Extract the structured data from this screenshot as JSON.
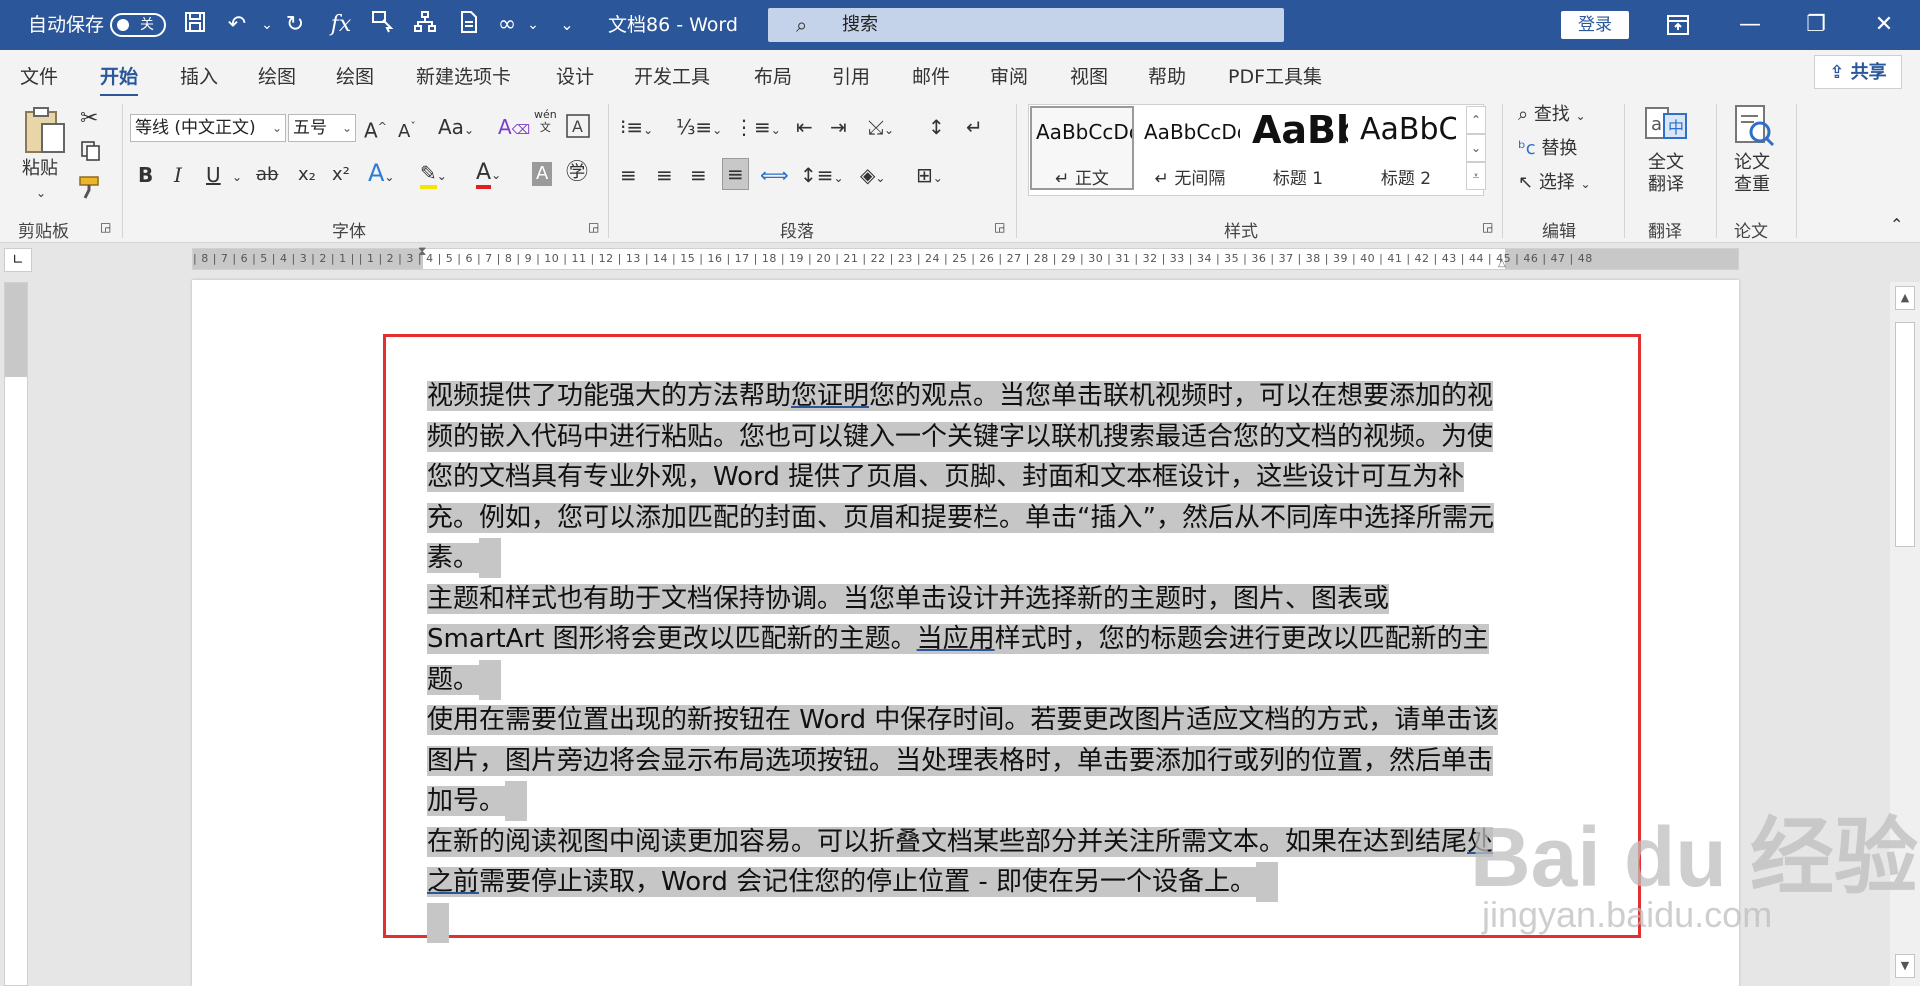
{
  "titlebar": {
    "autosave_label": "自动保存",
    "autosave_state": "关",
    "doc_title": "文档86  -  Word",
    "search_placeholder": "搜索",
    "login_label": "登录",
    "bg_color": "#2b579a"
  },
  "tabs": [
    "文件",
    "开始",
    "插入",
    "绘图",
    "绘图",
    "新建选项卡",
    "设计",
    "开发工具",
    "布局",
    "引用",
    "邮件",
    "审阅",
    "视图",
    "帮助",
    "PDF工具集"
  ],
  "active_tab": "开始",
  "share_label": "共享",
  "ribbon": {
    "clipboard": {
      "paste": "粘贴",
      "label": "剪贴板"
    },
    "font": {
      "font_name": "等线 (中文正文)",
      "font_size": "五号",
      "label": "字体",
      "grow": "A^",
      "shrink": "Aˇ",
      "case": "Aa",
      "bold": "B",
      "italic": "I",
      "underline": "U",
      "strike": "ab",
      "sub": "x₂",
      "sup": "x²",
      "phonetic": "wén\n文"
    },
    "paragraph": {
      "label": "段落"
    },
    "styles": {
      "label": "样式",
      "items": [
        {
          "preview": "AaBbCcDd",
          "name": "↵ 正文"
        },
        {
          "preview": "AaBbCcDd",
          "name": "↵ 无间隔"
        },
        {
          "preview": "AaBb",
          "name": "标题 1"
        },
        {
          "preview": "AaBbC",
          "name": "标题 2"
        }
      ]
    },
    "editing": {
      "find": "查找",
      "replace": "替换",
      "select": "选择",
      "label": "编辑"
    },
    "translate": {
      "button": "全文\n翻译",
      "label": "翻译"
    },
    "paper": {
      "button": "论文\n查重",
      "label": "论文"
    }
  },
  "ruler": {
    "numbers": "| 8 | 7 | 6 | 5 | 4 | 3 | 2 | 1 |   | 1 | 2 | 3 | 4 | 5 | 6 | 7 | 8 | 9 | 10 | 11 | 12 | 13 | 14 | 15 | 16 | 17 | 18 | 19 | 20 | 21 | 22 | 23 | 24 | 25 | 26 | 27 | 28 | 29 | 30 | 31 | 32 | 33 | 34 | 35 | 36 | 37 | 38 | 39 | 40 | 41 | 42 | 43 | 44 | 45 | 46 | 47 | 48"
  },
  "document": {
    "p1_a": "视频提供了功能强大的方法帮助",
    "p1_u": "您证明",
    "p1_b": "您的观点。当您单击联机视频时，可以在想要添加的视频的嵌入代码中进行粘贴。您也可以键入一个关键字以联机搜索最适合您的文档的视频。为使您的文档具有专业外观，Word 提供了页眉、页脚、封面和文本框设计，这些设计可互为补充。例如，您可以添加匹配的封面、页眉和提要栏。单击“插入”，然后从不同库中选择所需元素。",
    "p2_a": "主题和样式也有助于文档保持协调。当您单击设计并选择新的主题时，图片、图表或 SmartArt 图形将会更改以匹配新的主题。",
    "p2_u": "当应用",
    "p2_b": "样式时，您的标题会进行更改以匹配新的主题。",
    "p3": "使用在需要位置出现的新按钮在 Word 中保存时间。若要更改图片适应文档的方式，请单击该图片，图片旁边将会显示布局选项按钮。当处理表格时，单击要添加行或列的位置，然后单击加号。",
    "p4_a": "在新的阅读视图中阅读更加容易。可以折叠文档某些部分并关注所需文本。如果在达到结尾",
    "p4_u": "处之前",
    "p4_b": "需要停止读取，Word 会记住您的停止位置 - 即使在另一个设备上。",
    "highlight_color": "#c6c6c6",
    "box_color": "#e03030"
  },
  "watermark": {
    "big": "Bai du 经验",
    "small": "jingyan.baidu.com"
  }
}
